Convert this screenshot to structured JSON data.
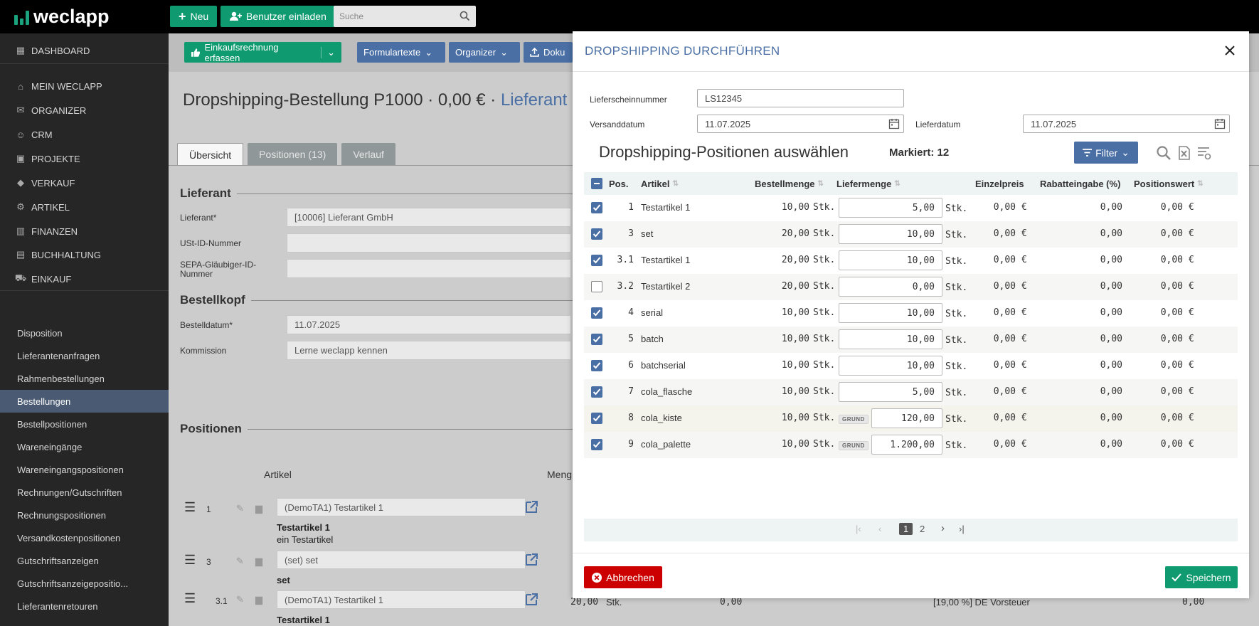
{
  "topbar": {
    "brand": "weclapp",
    "new_label": "Neu",
    "invite_label": "Benutzer einladen",
    "search_placeholder": "Suche"
  },
  "sidebar": {
    "items": [
      {
        "label": "DASHBOARD",
        "icon": "dashboard-icon"
      },
      {
        "label": "MEIN WECLAPP",
        "icon": "home-icon"
      },
      {
        "label": "ORGANIZER",
        "icon": "mail-icon"
      },
      {
        "label": "CRM",
        "icon": "people-icon"
      },
      {
        "label": "PROJEKTE",
        "icon": "briefcase-icon"
      },
      {
        "label": "VERKAUF",
        "icon": "tag-icon"
      },
      {
        "label": "ARTIKEL",
        "icon": "gear-icon"
      },
      {
        "label": "FINANZEN",
        "icon": "bank-icon"
      },
      {
        "label": "BUCHHALTUNG",
        "icon": "calculator-icon"
      },
      {
        "label": "EINKAUF",
        "icon": "cart-icon"
      }
    ],
    "sub_items": [
      "Disposition",
      "Lieferantenanfragen",
      "Rahmenbestellungen",
      "Bestellungen",
      "Bestellpositionen",
      "Wareneingänge",
      "Wareneingangspositionen",
      "Rechnungen/Gutschriften",
      "Rechnungspositionen",
      "Versandkostenpositionen",
      "Gutschriftsanzeigen",
      "Gutschriftsanzeigepositio...",
      "Lieferantenretouren"
    ],
    "active_sub": "Bestellungen"
  },
  "main": {
    "toolbar": {
      "purchase_invoice": "Einkaufsrechnung erfassen",
      "form_texts": "Formulartexte",
      "organizer": "Organizer",
      "documents": "Doku"
    },
    "title_prefix": "Dropshipping-Bestellung P1000 · 0,00 € ·",
    "title_link": "Lieferant",
    "tabs": [
      "Übersicht",
      "Positionen (13)",
      "Verlauf"
    ],
    "supplier_section": "Lieferant",
    "fields": {
      "supplier_label": "Lieferant*",
      "supplier_value": "[10006] Lieferant GmbH",
      "vat_label": "USt-ID-Nummer",
      "sepa_label": "SEPA-Gläubiger-ID-Nummer"
    },
    "order_section": "Bestellkopf",
    "order_fields": {
      "date_label": "Bestelldatum*",
      "date_value": "11.07.2025",
      "commission_label": "Kommission",
      "commission_value": "Lerne weclapp kennen"
    },
    "positions_section": "Positionen",
    "positions_col_article": "Artikel",
    "positions_col_qty": "Meng",
    "positions": [
      {
        "num": "1",
        "article": "(DemoTA1) Testartikel 1",
        "name": "Testartikel 1",
        "desc": "ein Testartikel"
      },
      {
        "num": "3",
        "article": "(set) set",
        "name": "set",
        "desc": ""
      },
      {
        "num": "3.1",
        "article": "(DemoTA1) Testartikel 1",
        "name": "Testartikel 1",
        "desc": "",
        "qty": "20,00",
        "unit": "Stk.",
        "price": "0,00",
        "tax": "[19,00 %] DE Vorsteuer",
        "total": "0,00"
      }
    ]
  },
  "modal": {
    "title": "DROPSHIPPING DURCHFÜHREN",
    "delivery_note_label": "Lieferscheinnummer",
    "delivery_note_value": "LS12345",
    "ship_date_label": "Versanddatum",
    "ship_date_value": "11.07.2025",
    "delivery_date_label": "Lieferdatum",
    "delivery_date_value": "11.07.2025",
    "positions_title": "Dropshipping-Positionen auswählen",
    "marked": "Markiert: 12",
    "filter_label": "Filter",
    "columns": [
      "Pos.",
      "Artikel",
      "Bestellmenge",
      "Liefermenge",
      "Einzelpreis",
      "Rabatteingabe (%)",
      "Positionswert"
    ],
    "rows": [
      {
        "checked": true,
        "pos": "1",
        "article": "Testartikel 1",
        "order_qty": "10,00",
        "unit": "Stk.",
        "delivery_qty": "5,00",
        "grund": false,
        "price": "0,00",
        "currency": "€",
        "discount": "0,00",
        "value": "0,00"
      },
      {
        "checked": true,
        "pos": "3",
        "article": "set",
        "order_qty": "20,00",
        "unit": "Stk.",
        "delivery_qty": "10,00",
        "grund": false,
        "price": "0,00",
        "currency": "€",
        "discount": "0,00",
        "value": "0,00"
      },
      {
        "checked": true,
        "pos": "3.1",
        "article": "Testartikel 1",
        "order_qty": "20,00",
        "unit": "Stk.",
        "delivery_qty": "10,00",
        "grund": false,
        "price": "0,00",
        "currency": "€",
        "discount": "0,00",
        "value": "0,00"
      },
      {
        "checked": false,
        "pos": "3.2",
        "article": "Testartikel 2",
        "order_qty": "20,00",
        "unit": "Stk.",
        "delivery_qty": "0,00",
        "grund": false,
        "price": "0,00",
        "currency": "€",
        "discount": "0,00",
        "value": "0,00"
      },
      {
        "checked": true,
        "pos": "4",
        "article": "serial",
        "order_qty": "10,00",
        "unit": "Stk.",
        "delivery_qty": "10,00",
        "grund": false,
        "price": "0,00",
        "currency": "€",
        "discount": "0,00",
        "value": "0,00"
      },
      {
        "checked": true,
        "pos": "5",
        "article": "batch",
        "order_qty": "10,00",
        "unit": "Stk.",
        "delivery_qty": "10,00",
        "grund": false,
        "price": "0,00",
        "currency": "€",
        "discount": "0,00",
        "value": "0,00"
      },
      {
        "checked": true,
        "pos": "6",
        "article": "batchserial",
        "order_qty": "10,00",
        "unit": "Stk.",
        "delivery_qty": "10,00",
        "grund": false,
        "price": "0,00",
        "currency": "€",
        "discount": "0,00",
        "value": "0,00"
      },
      {
        "checked": true,
        "pos": "7",
        "article": "cola_flasche",
        "order_qty": "10,00",
        "unit": "Stk.",
        "delivery_qty": "5,00",
        "grund": false,
        "price": "0,00",
        "currency": "€",
        "discount": "0,00",
        "value": "0,00"
      },
      {
        "checked": true,
        "pos": "8",
        "article": "cola_kiste",
        "order_qty": "10,00",
        "unit": "Stk.",
        "delivery_qty": "120,00",
        "grund": true,
        "price": "0,00",
        "currency": "€",
        "discount": "0,00",
        "value": "0,00"
      },
      {
        "checked": true,
        "pos": "9",
        "article": "cola_palette",
        "order_qty": "10,00",
        "unit": "Stk.",
        "delivery_qty": "1.200,00",
        "grund": true,
        "price": "0,00",
        "currency": "€",
        "discount": "0,00",
        "value": "0,00"
      }
    ],
    "grund_label": "GRUND",
    "pages": [
      "1",
      "2"
    ],
    "current_page": "1",
    "cancel_label": "Abbrechen",
    "save_label": "Speichern"
  }
}
